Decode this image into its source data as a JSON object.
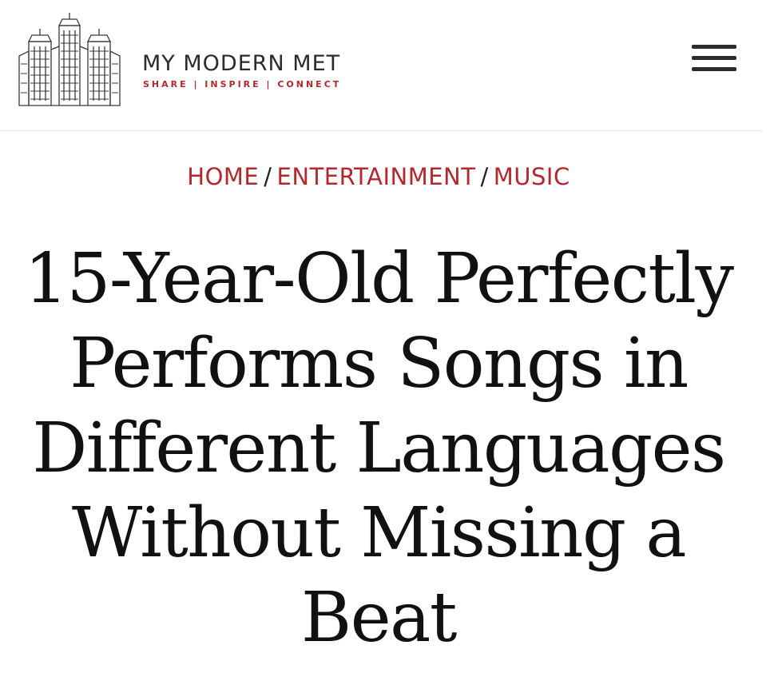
{
  "header": {
    "logo": {
      "title": "MY MODERN MET",
      "tagline": "SHARE | INSPIRE | CONNECT",
      "icon": "city-skyline-logo-icon"
    },
    "menu_icon": "hamburger-menu-icon"
  },
  "breadcrumb": {
    "items": [
      {
        "label": "HOME"
      },
      {
        "label": "ENTERTAINMENT"
      },
      {
        "label": "MUSIC"
      }
    ],
    "separator": "/"
  },
  "article": {
    "title": "15-Year-Old Perfectly Performs Songs in Different Languages Without Missing a Beat"
  },
  "colors": {
    "brand_red": "#b3282d",
    "text_dark": "#111111",
    "logo_gray": "#2b2b2b"
  }
}
